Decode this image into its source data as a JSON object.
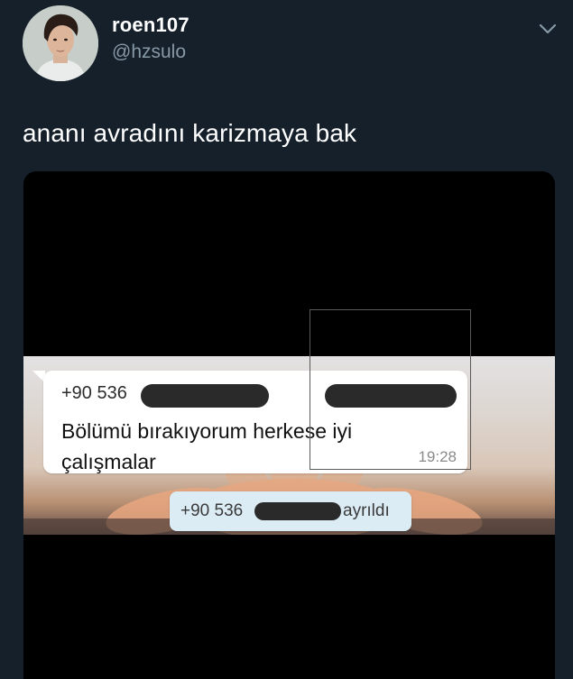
{
  "user": {
    "display_name": "roen107",
    "handle": "@hzsulo"
  },
  "tweet": {
    "text": "ananı avradını karizmaya bak"
  },
  "media": {
    "message": {
      "sender_prefix": "+90 536",
      "body_line1": "Bölümü bırakıyorum herkese iyi",
      "body_line2": "çalışmalar",
      "time": "19:28"
    },
    "system_notice": {
      "prefix": "+90 536",
      "suffix": "ayrıldı"
    }
  },
  "icons": {
    "menu": "chevron-down-icon"
  },
  "colors": {
    "background": "#15202b",
    "handle_gray": "#8899a6",
    "bubble": "#ffffff",
    "system_bubble": "#dcecf5",
    "redaction": "#2a2a2a"
  }
}
